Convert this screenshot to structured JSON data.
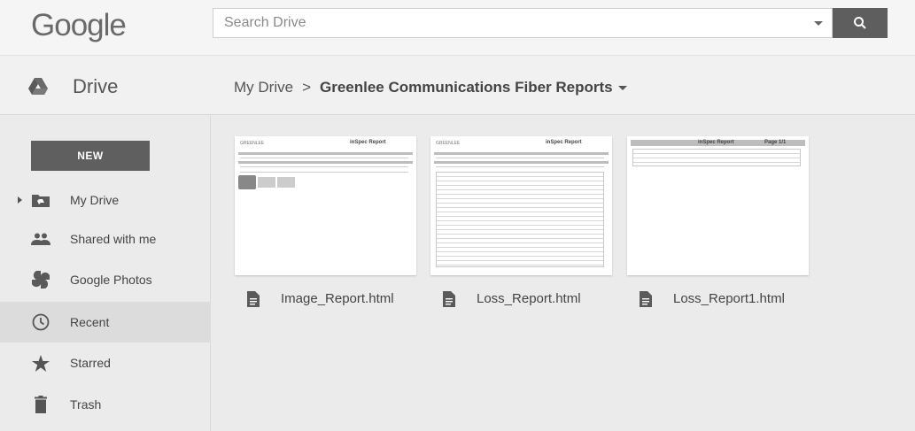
{
  "header": {
    "logo_text": "Google",
    "search_placeholder": "Search Drive"
  },
  "drive_bar": {
    "title": "Drive",
    "breadcrumb_root": "My Drive",
    "breadcrumb_separator": ">",
    "breadcrumb_current": "Greenlee Communications Fiber Reports"
  },
  "sidebar": {
    "new_label": "NEW",
    "items": [
      {
        "label": "My Drive",
        "icon": "my-drive-icon"
      },
      {
        "label": "Shared with me",
        "icon": "shared-icon"
      },
      {
        "label": "Google Photos",
        "icon": "photos-icon"
      },
      {
        "label": "Recent",
        "icon": "clock-icon"
      },
      {
        "label": "Starred",
        "icon": "star-icon"
      },
      {
        "label": "Trash",
        "icon": "trash-icon"
      }
    ],
    "active_item": "Recent"
  },
  "files": [
    {
      "name": "Image_Report.html",
      "thumb_title": "inSpec Report",
      "thumb_logo": "GREENLEE"
    },
    {
      "name": "Loss_Report.html",
      "thumb_title": "inSpec Report",
      "thumb_logo": "GREENLEE"
    },
    {
      "name": "Loss_Report1.html",
      "thumb_title": "inSpec Report",
      "thumb_extra": "Page 1/1"
    }
  ],
  "colors": {
    "top_bg": "#f5f5f5",
    "search_button": "#5e5e5e",
    "new_button": "#5f5f5f",
    "active_nav": "#dcdcdc"
  }
}
